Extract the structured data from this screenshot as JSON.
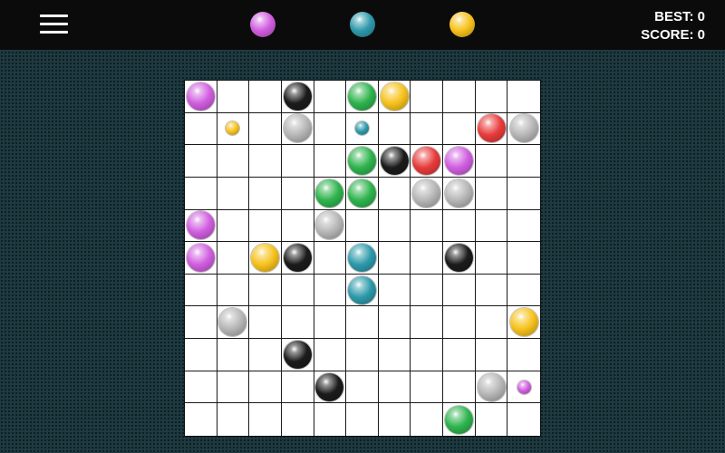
{
  "header": {
    "best_label": "BEST: 0",
    "score_label": "SCORE: 0"
  },
  "icons": {
    "menu": "hamburger-menu-icon"
  },
  "colors": {
    "purple": "#d15ee0",
    "teal": "#2e9aab",
    "yellow": "#f7c21c",
    "gray": "#b7b7b7",
    "black": "#1b1b1b",
    "green": "#2fb44e",
    "red": "#e83b3b"
  },
  "next_balls": [
    "purple",
    "teal",
    "yellow"
  ],
  "board": {
    "size": 11,
    "balls": [
      {
        "r": 0,
        "c": 0,
        "color": "purple",
        "size": "big"
      },
      {
        "r": 0,
        "c": 3,
        "color": "black",
        "size": "big"
      },
      {
        "r": 0,
        "c": 5,
        "color": "green",
        "size": "big"
      },
      {
        "r": 0,
        "c": 6,
        "color": "yellow",
        "size": "big"
      },
      {
        "r": 1,
        "c": 1,
        "color": "yellow",
        "size": "small"
      },
      {
        "r": 1,
        "c": 3,
        "color": "gray",
        "size": "big"
      },
      {
        "r": 1,
        "c": 5,
        "color": "teal",
        "size": "small"
      },
      {
        "r": 1,
        "c": 9,
        "color": "red",
        "size": "big"
      },
      {
        "r": 1,
        "c": 10,
        "color": "gray",
        "size": "big"
      },
      {
        "r": 2,
        "c": 5,
        "color": "green",
        "size": "big"
      },
      {
        "r": 2,
        "c": 6,
        "color": "black",
        "size": "big"
      },
      {
        "r": 2,
        "c": 7,
        "color": "red",
        "size": "big"
      },
      {
        "r": 2,
        "c": 8,
        "color": "purple",
        "size": "big"
      },
      {
        "r": 3,
        "c": 4,
        "color": "green",
        "size": "big"
      },
      {
        "r": 3,
        "c": 5,
        "color": "green",
        "size": "big"
      },
      {
        "r": 3,
        "c": 7,
        "color": "gray",
        "size": "big"
      },
      {
        "r": 3,
        "c": 8,
        "color": "gray",
        "size": "big"
      },
      {
        "r": 4,
        "c": 0,
        "color": "purple",
        "size": "big"
      },
      {
        "r": 4,
        "c": 4,
        "color": "gray",
        "size": "big"
      },
      {
        "r": 5,
        "c": 0,
        "color": "purple",
        "size": "big"
      },
      {
        "r": 5,
        "c": 2,
        "color": "yellow",
        "size": "big"
      },
      {
        "r": 5,
        "c": 3,
        "color": "black",
        "size": "big"
      },
      {
        "r": 5,
        "c": 5,
        "color": "teal",
        "size": "big"
      },
      {
        "r": 5,
        "c": 8,
        "color": "black",
        "size": "big"
      },
      {
        "r": 6,
        "c": 5,
        "color": "teal",
        "size": "big"
      },
      {
        "r": 7,
        "c": 1,
        "color": "gray",
        "size": "big"
      },
      {
        "r": 7,
        "c": 10,
        "color": "yellow",
        "size": "big"
      },
      {
        "r": 8,
        "c": 3,
        "color": "black",
        "size": "big"
      },
      {
        "r": 9,
        "c": 4,
        "color": "black",
        "size": "big"
      },
      {
        "r": 9,
        "c": 9,
        "color": "gray",
        "size": "big"
      },
      {
        "r": 9,
        "c": 10,
        "color": "purple",
        "size": "small"
      },
      {
        "r": 10,
        "c": 8,
        "color": "green",
        "size": "big"
      }
    ]
  }
}
